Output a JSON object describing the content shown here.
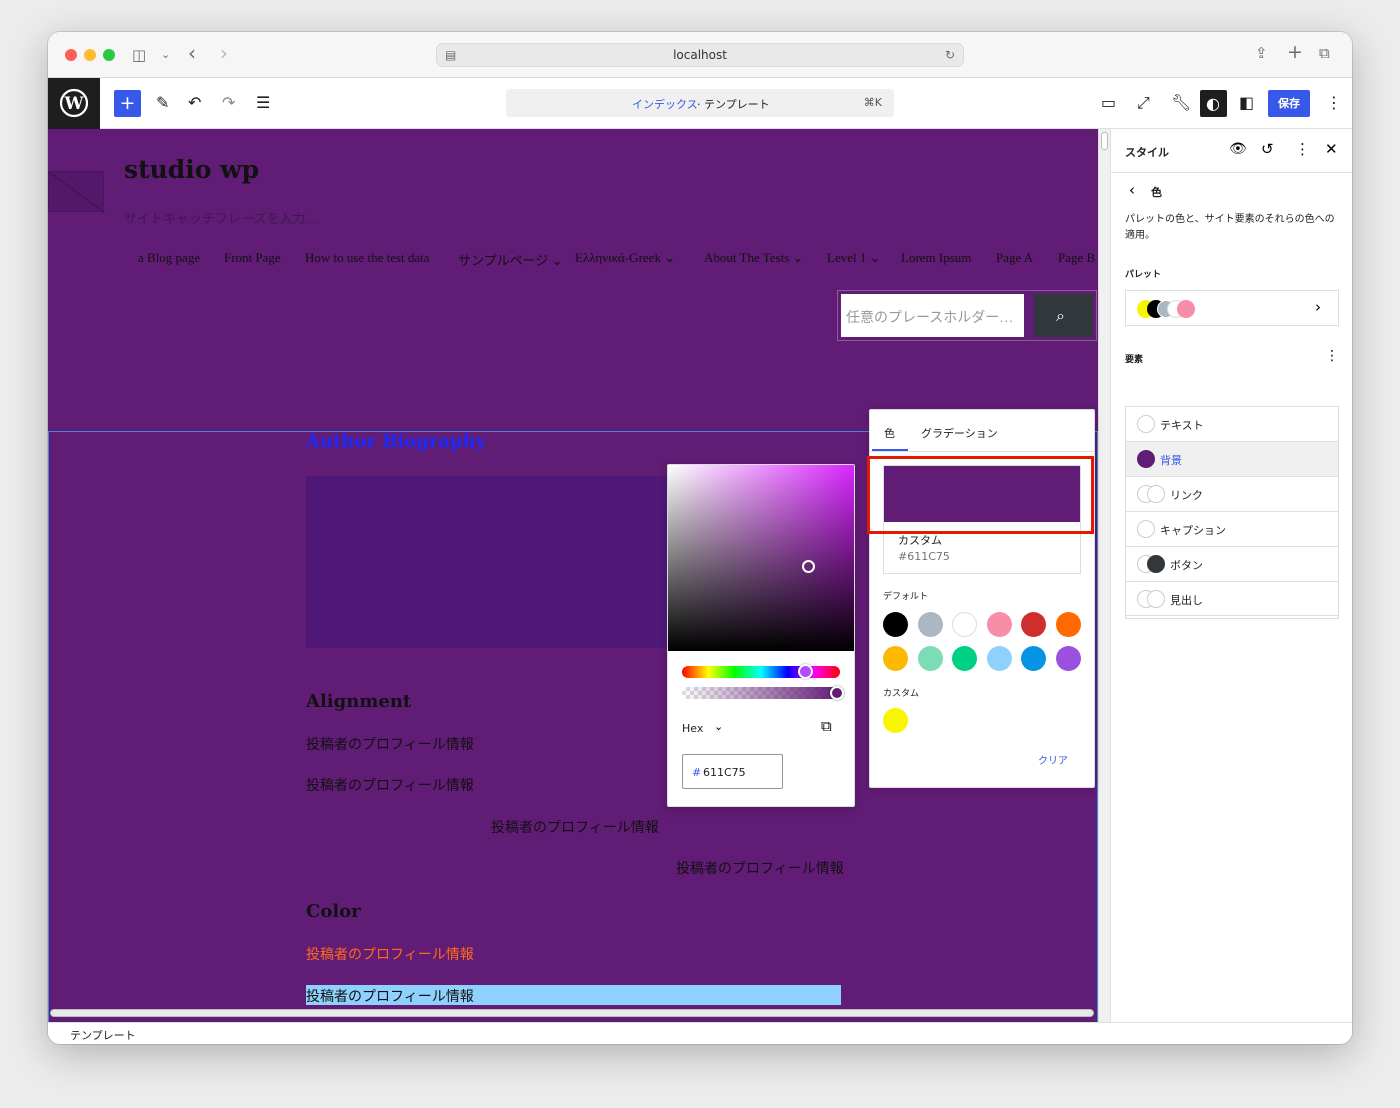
{
  "browser": {
    "url": "localhost"
  },
  "toolbar": {
    "command_title": "インデックス",
    "command_subtitle": "· テンプレート",
    "shortcut": "⌘K",
    "save_label": "保存"
  },
  "site": {
    "title": "studio wp",
    "tagline": "サイトキャッチフレーズを入力…",
    "nav": [
      "a Blog page",
      "Front Page",
      "How to use the test data",
      "サンプルページ ⌄",
      "Ελληνικά-Greek ⌄",
      "About The Tests ⌄",
      "Level 1 ⌄",
      "Lorem Ipsum",
      "Page A",
      "Page B"
    ],
    "search_placeholder": "任意のプレースホルダー…"
  },
  "content": {
    "author_bio_heading": "Author Biography",
    "alignment_heading": "Alignment",
    "para_text": "投稿者のプロフィール情報",
    "color_heading": "Color"
  },
  "sidebar": {
    "title": "スタイル",
    "back_label": "色",
    "description": "パレットの色と、サイト要素のそれらの色への適用。",
    "palette_label": "パレット",
    "elements_label": "要素",
    "elements": [
      "テキスト",
      "背景",
      "リンク",
      "キャプション",
      "ボタン",
      "見出し"
    ]
  },
  "color_popover": {
    "tab_color": "色",
    "tab_gradient": "グラデーション",
    "current_name": "カスタム",
    "current_value": "#611C75",
    "default_label": "デフォルト",
    "custom_label": "カスタム",
    "clear_label": "クリア",
    "default_colors": [
      "#000000",
      "#abb8c3",
      "#ffffff",
      "#f78da7",
      "#cf2e2e",
      "#ff6900",
      "#fcb900",
      "#7bdcb5",
      "#00d084",
      "#8ed1fc",
      "#0693e3",
      "#9b51e0"
    ],
    "custom_colors": [
      "#f6f600"
    ]
  },
  "picker": {
    "format_label": "Hex",
    "hex_value": "611C75"
  },
  "status": {
    "breadcrumb": "テンプレート"
  },
  "colors": {
    "background": "#611c75",
    "accent": "#3858e9",
    "highlight_box": "#e21b00"
  }
}
